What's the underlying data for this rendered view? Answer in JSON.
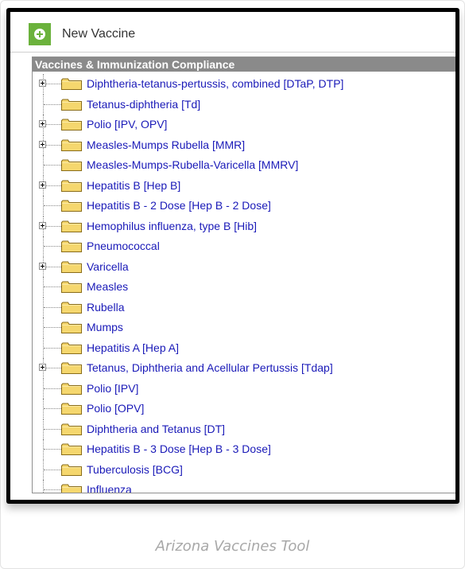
{
  "toolbar": {
    "new_label": "New Vaccine"
  },
  "panel": {
    "header": "Vaccines & Immunization Compliance"
  },
  "tree": [
    {
      "label": "Diphtheria-tetanus-pertussis, combined [DTaP, DTP]",
      "expandable": true
    },
    {
      "label": "Tetanus-diphtheria [Td]",
      "expandable": false
    },
    {
      "label": "Polio [IPV, OPV]",
      "expandable": true
    },
    {
      "label": "Measles-Mumps Rubella [MMR]",
      "expandable": true
    },
    {
      "label": "Measles-Mumps-Rubella-Varicella [MMRV]",
      "expandable": false
    },
    {
      "label": "Hepatitis B [Hep B]",
      "expandable": true
    },
    {
      "label": "Hepatitis B - 2 Dose [Hep B - 2 Dose]",
      "expandable": false
    },
    {
      "label": "Hemophilus influenza, type B [Hib]",
      "expandable": true
    },
    {
      "label": "Pneumococcal",
      "expandable": false
    },
    {
      "label": "Varicella",
      "expandable": true
    },
    {
      "label": "Measles",
      "expandable": false
    },
    {
      "label": "Rubella",
      "expandable": false
    },
    {
      "label": "Mumps",
      "expandable": false
    },
    {
      "label": "Hepatitis A [Hep A]",
      "expandable": false
    },
    {
      "label": "Tetanus, Diphtheria and Acellular Pertussis [Tdap]",
      "expandable": true
    },
    {
      "label": "Polio [IPV]",
      "expandable": false
    },
    {
      "label": "Polio [OPV]",
      "expandable": false
    },
    {
      "label": "Diphtheria and Tetanus [DT]",
      "expandable": false
    },
    {
      "label": "Hepatitis B - 3 Dose [Hep B - 3 Dose]",
      "expandable": false
    },
    {
      "label": "Tuberculosis [BCG]",
      "expandable": false
    },
    {
      "label": "Influenza",
      "expandable": false
    }
  ],
  "caption": "Arizona Vaccines Tool",
  "colors": {
    "accent": "#6bb23c",
    "link": "#1a1ab8",
    "header_bg": "#8a8a8a",
    "folder": "#f5d76e"
  }
}
